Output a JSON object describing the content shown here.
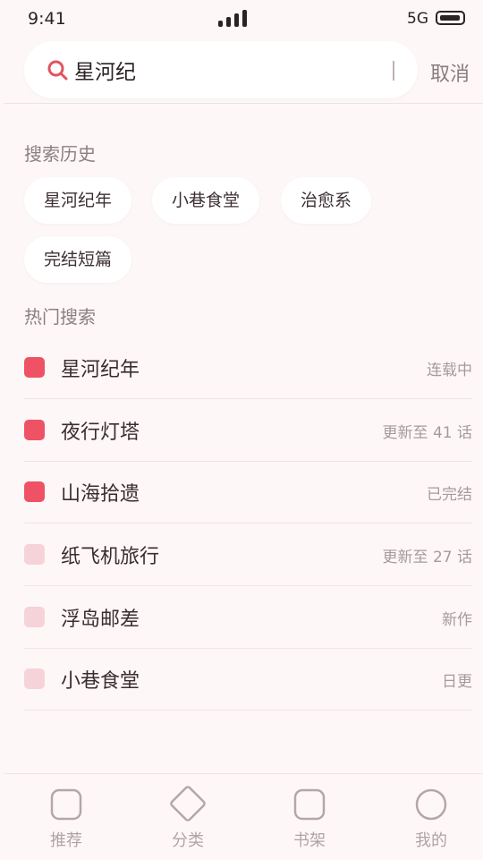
{
  "status_bar": {
    "time": "9:41",
    "network": "5G"
  },
  "search": {
    "value": "星河纪",
    "cancel_label": "取消"
  },
  "history": {
    "title": "搜索历史",
    "items": [
      "星河纪年",
      "小巷食堂",
      "治愈系",
      "完结短篇"
    ]
  },
  "hot": {
    "title": "热门搜索",
    "items": [
      {
        "title": "星河纪年",
        "status": "连载中",
        "highlight": true
      },
      {
        "title": "夜行灯塔",
        "status": "更新至 41 话",
        "highlight": true
      },
      {
        "title": "山海拾遗",
        "status": "已完结",
        "highlight": true
      },
      {
        "title": "纸飞机旅行",
        "status": "更新至 27 话",
        "highlight": false
      },
      {
        "title": "浮岛邮差",
        "status": "新作",
        "highlight": false
      },
      {
        "title": "小巷食堂",
        "status": "日更",
        "highlight": false
      }
    ]
  },
  "nav": {
    "items": [
      {
        "label": "推荐",
        "icon": "rounded-square-icon"
      },
      {
        "label": "分类",
        "icon": "diamond-icon"
      },
      {
        "label": "书架",
        "icon": "rounded-square-icon"
      },
      {
        "label": "我的",
        "icon": "circle-icon"
      }
    ]
  },
  "colors": {
    "accent": "#ef5265",
    "rank_muted": "#f5d3d8",
    "background": "#fdf8f7"
  }
}
